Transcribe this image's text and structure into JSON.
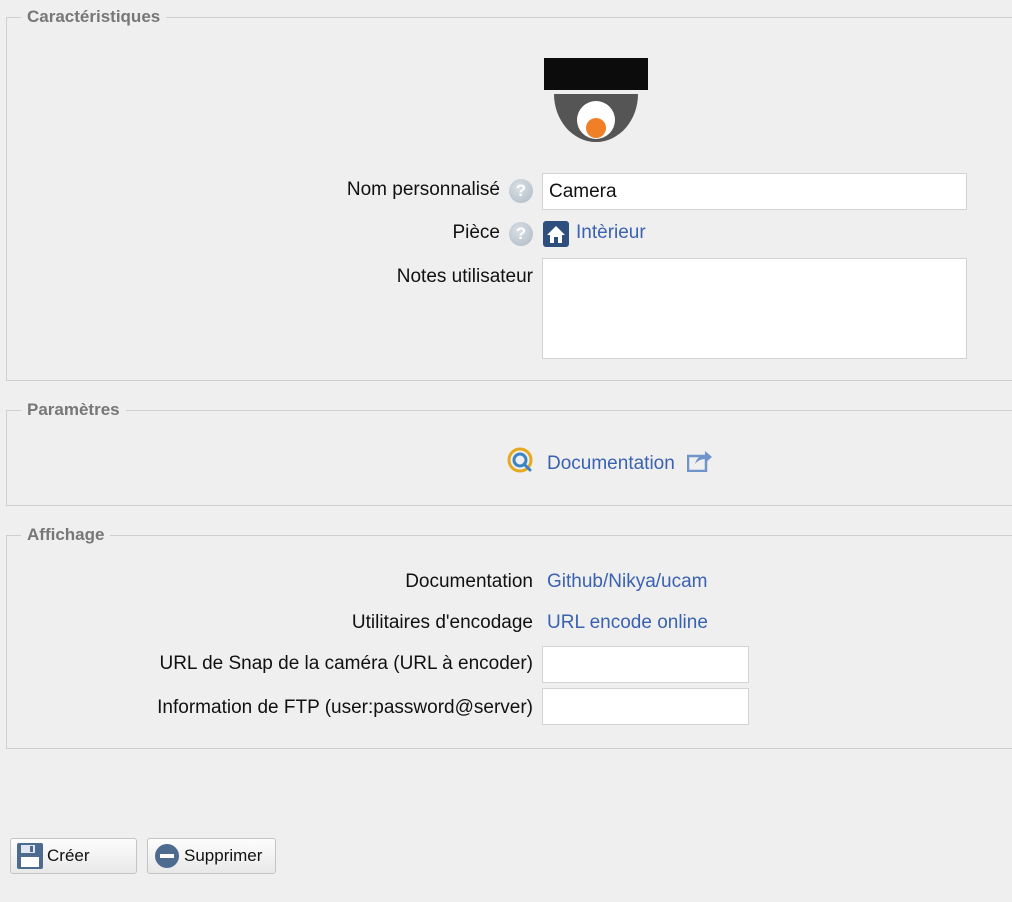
{
  "sections": {
    "caracteristiques": "Caractéristiques",
    "parametres": "Paramètres",
    "affichage": "Affichage"
  },
  "caracteristiques": {
    "image_icon": "dome-camera-icon",
    "name_label": "Nom personnalisé",
    "name_value": "Camera",
    "room_label": "Pièce",
    "room_icon": "home-icon",
    "room_value": "Intèrieur",
    "notes_label": "Notes utilisateur",
    "notes_value": ""
  },
  "parametres": {
    "doc_icon": "plugin-doc-icon",
    "doc_link": "Documentation",
    "external_icon": "external-link-icon"
  },
  "affichage": {
    "doc_label": "Documentation",
    "doc_link": "Github/Nikya/ucam",
    "encode_label": "Utilitaires d'encodage",
    "encode_link": "URL encode online",
    "snap_label": "URL de Snap de la caméra (URL à encoder)",
    "snap_value": "",
    "ftp_label": "Information de FTP (user:password@server)",
    "ftp_value": ""
  },
  "buttons": {
    "create": "Créer",
    "delete": "Supprimer"
  },
  "colors": {
    "link": "#3a62b0",
    "background": "#efefef",
    "legend": "#777777",
    "camera_lens": "#f08028"
  }
}
